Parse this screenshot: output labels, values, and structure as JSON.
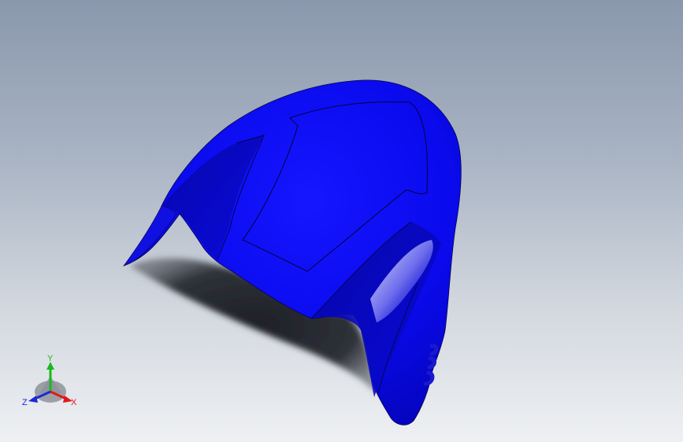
{
  "viewport": {
    "background_top": "#8a98ad",
    "background_bottom": "#eef0f3"
  },
  "model": {
    "part_color": "#0a0aee",
    "edge_color": "#05054a",
    "shadow_color": "#2a2c33"
  },
  "triad": {
    "x_label": "X",
    "y_label": "Y",
    "z_label": "Z",
    "x_color": "#e01a1a",
    "y_color": "#19b81e",
    "z_color": "#1a2ad8"
  }
}
